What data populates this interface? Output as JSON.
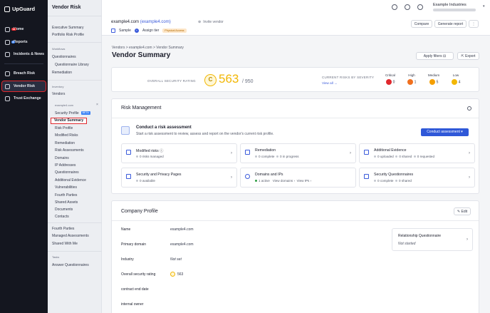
{
  "nav": {
    "logo": "UpGuard",
    "items": [
      {
        "label": "Home",
        "badge": "14",
        "icon": "home-icon"
      },
      {
        "label": "Reports",
        "badge": "8",
        "icon": "reports-icon"
      },
      {
        "label": "Incidents & News",
        "icon": "incidents-icon"
      },
      {
        "label": "Breach Risk",
        "icon": "breach-icon"
      },
      {
        "label": "Vendor Risk",
        "icon": "vendor-icon"
      },
      {
        "label": "Trust Exchange",
        "icon": "trust-icon"
      }
    ]
  },
  "sidebar": {
    "title": "Vendor Risk",
    "top_items": [
      "Executive Summary",
      "Portfolio Risk Profile"
    ],
    "workflows_label": "Workflows",
    "workflows": [
      "Questionnaires",
      "Questionnaire Library",
      "Remediation"
    ],
    "inventory_label": "Inventory",
    "inventory": [
      "Vendors"
    ],
    "vendor_label": "example4.com",
    "vendor_close": "×",
    "vendor_items": [
      "Security Profile",
      "Vendor Summary",
      "Risk Profile",
      "Modified Risks",
      "Remediation",
      "Risk Assessments",
      "Domains",
      "IP Addresses",
      "Questionnaires",
      "Additional Evidence",
      "Vulnerabilities",
      "Fourth Parties",
      "Shared Assets",
      "Documents",
      "Contacts"
    ],
    "beta": "BETA",
    "bottom_items": [
      "Fourth Parties",
      "Managed Assessments",
      "Shared With Me"
    ],
    "tasks_label": "Tasks",
    "tasks": [
      "Answer Questionnaires"
    ]
  },
  "topbar": {
    "vendor": "example4.com",
    "vendor_link": "(example4.com)",
    "invite": "Invite vendor",
    "sample": "Sample",
    "assign": "Assign tier",
    "physical": "Physical Access",
    "compare": "Compare",
    "generate": "Generate report",
    "more": "⋮",
    "org": "Example Industries"
  },
  "breadcrumb": "Vendors  >  example4.com  >  Vendor Summary",
  "page_title": "Vendor Summary",
  "apply_filters": "Apply filters",
  "export": "Export",
  "rating": {
    "label": "OVERALL SECURITY RATING",
    "grade": "C",
    "score": "563",
    "max": "/ 950",
    "color": "#f2b705"
  },
  "severity": {
    "title": "CURRENT RISKS BY SEVERITY",
    "view_all": "View all",
    "items": [
      {
        "label": "Critical",
        "count": "0",
        "color": "#e0282d"
      },
      {
        "label": "High",
        "count": "1",
        "color": "#f0701f"
      },
      {
        "label": "Medium",
        "count": "5",
        "color": "#f59f00"
      },
      {
        "label": "Low",
        "count": "4",
        "color": "#f2b705"
      }
    ]
  },
  "risk_mgmt": {
    "title": "Risk Management",
    "assess_title": "Conduct a risk assessment",
    "assess_desc": "Start a risk assessment to review, assess and report on the vendor's current risk profile.",
    "assess_button": "Conduct assessment",
    "tiles": [
      {
        "title": "Modified risks",
        "sub": [
          "0 risks managed"
        ]
      },
      {
        "title": "Remediation",
        "sub": [
          "0 complete",
          "0 in progress"
        ]
      },
      {
        "title": "Additional Evidence",
        "sub": [
          "0 uploaded",
          "0 shared",
          "0 requested"
        ]
      },
      {
        "title": "Security and Privacy Pages",
        "sub": [
          "0 available"
        ]
      },
      {
        "title": "Domains and IPs",
        "sub": [
          "1 active",
          "View domains",
          "View IPs"
        ]
      },
      {
        "title": "Security Questionnaires",
        "sub": [
          "0 complete",
          "0 shared"
        ]
      }
    ]
  },
  "profile": {
    "title": "Company Profile",
    "edit": "Edit",
    "rows": [
      {
        "label": "Name",
        "value": "example4.com"
      },
      {
        "label": "Primary domain",
        "value": "example4.com"
      },
      {
        "label": "Industry",
        "value": "Not set"
      },
      {
        "label": "Overall security rating",
        "value": "563"
      },
      {
        "label": "contract end date",
        "value": ""
      },
      {
        "label": "internal owner",
        "value": ""
      }
    ],
    "rq_title": "Relationship Questionnaire",
    "rq_status": "Not started"
  }
}
